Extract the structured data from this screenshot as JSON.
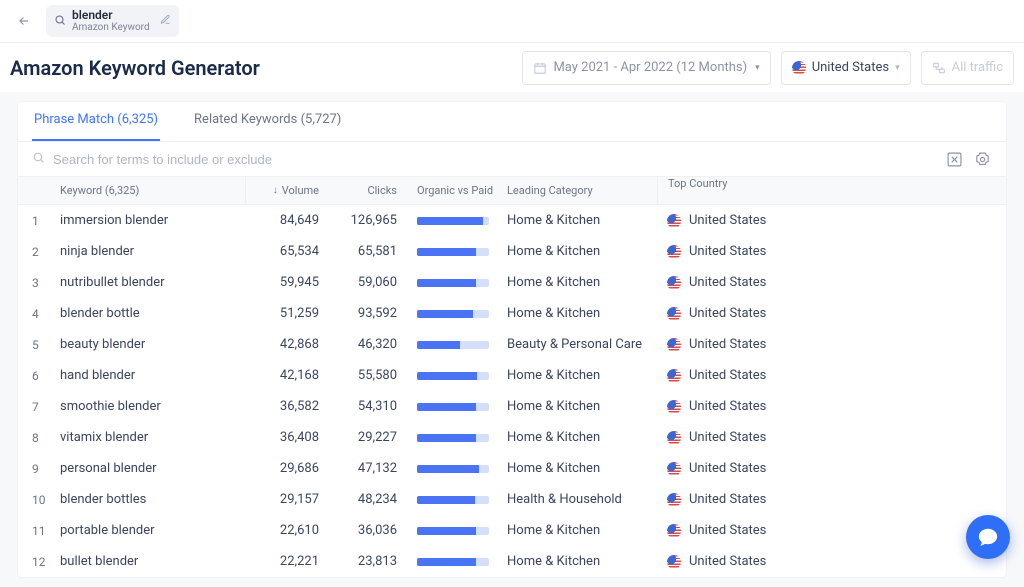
{
  "search": {
    "term": "blender",
    "subterm": "Amazon Keyword"
  },
  "page_title": "Amazon Keyword Generator",
  "date_range": "May 2021 - Apr 2022 (12 Months)",
  "country": "United States",
  "traffic_label": "All traffic",
  "tabs": [
    {
      "label": "Phrase Match (6,325)",
      "active": true
    },
    {
      "label": "Related Keywords (5,727)",
      "active": false
    }
  ],
  "search_placeholder": "Search for terms to include or exclude",
  "columns": {
    "keyword": "Keyword (6,325)",
    "volume": "Volume",
    "clicks": "Clicks",
    "organic_paid": "Organic vs Paid",
    "leading_category": "Leading Category",
    "top_country": "Top Country"
  },
  "rows": [
    {
      "idx": "1",
      "keyword": "immersion blender",
      "volume": "84,649",
      "clicks": "126,965",
      "bar": 92,
      "category": "Home & Kitchen",
      "country": "United States"
    },
    {
      "idx": "2",
      "keyword": "ninja blender",
      "volume": "65,534",
      "clicks": "65,581",
      "bar": 82,
      "category": "Home & Kitchen",
      "country": "United States"
    },
    {
      "idx": "3",
      "keyword": "nutribullet blender",
      "volume": "59,945",
      "clicks": "59,060",
      "bar": 82,
      "category": "Home & Kitchen",
      "country": "United States"
    },
    {
      "idx": "4",
      "keyword": "blender bottle",
      "volume": "51,259",
      "clicks": "93,592",
      "bar": 78,
      "category": "Home & Kitchen",
      "country": "United States"
    },
    {
      "idx": "5",
      "keyword": "beauty blender",
      "volume": "42,868",
      "clicks": "46,320",
      "bar": 60,
      "category": "Beauty & Personal Care",
      "country": "United States"
    },
    {
      "idx": "6",
      "keyword": "hand blender",
      "volume": "42,168",
      "clicks": "55,580",
      "bar": 84,
      "category": "Home & Kitchen",
      "country": "United States"
    },
    {
      "idx": "7",
      "keyword": "smoothie blender",
      "volume": "36,582",
      "clicks": "54,310",
      "bar": 82,
      "category": "Home & Kitchen",
      "country": "United States"
    },
    {
      "idx": "8",
      "keyword": "vitamix blender",
      "volume": "36,408",
      "clicks": "29,227",
      "bar": 82,
      "category": "Home & Kitchen",
      "country": "United States"
    },
    {
      "idx": "9",
      "keyword": "personal blender",
      "volume": "29,686",
      "clicks": "47,132",
      "bar": 86,
      "category": "Home & Kitchen",
      "country": "United States"
    },
    {
      "idx": "10",
      "keyword": "blender bottles",
      "volume": "29,157",
      "clicks": "48,234",
      "bar": 80,
      "category": "Health & Household",
      "country": "United States"
    },
    {
      "idx": "11",
      "keyword": "portable blender",
      "volume": "22,610",
      "clicks": "36,036",
      "bar": 82,
      "category": "Home & Kitchen",
      "country": "United States"
    },
    {
      "idx": "12",
      "keyword": "bullet blender",
      "volume": "22,221",
      "clicks": "23,813",
      "bar": 82,
      "category": "Home & Kitchen",
      "country": "United States"
    }
  ]
}
